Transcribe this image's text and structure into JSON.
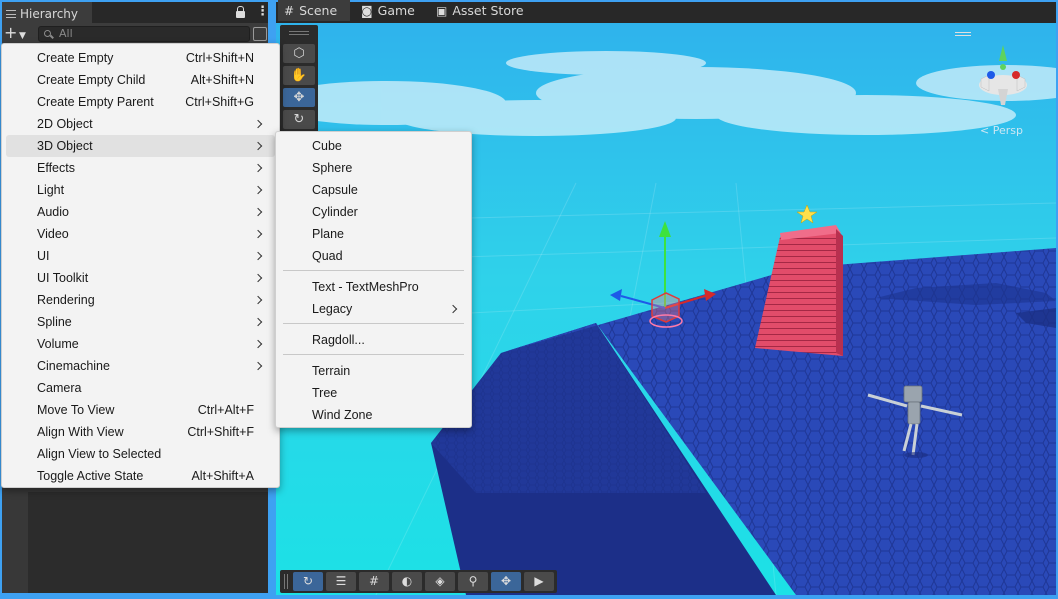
{
  "hierarchy": {
    "tab_title": "Hierarchy",
    "search_placeholder": "All",
    "add_icon": "plus-icon"
  },
  "scene": {
    "tabs": [
      {
        "label": "Scene",
        "icon": "hash-grid-icon",
        "active": true
      },
      {
        "label": "Game",
        "icon": "gamepad-icon",
        "active": false
      },
      {
        "label": "Asset Store",
        "icon": "shopping-bag-icon",
        "active": false
      }
    ],
    "camera_mode": "< Persp",
    "tools": [
      "view-cube-icon",
      "hand-tool-icon",
      "move-tool-icon",
      "rotate-tool-icon"
    ],
    "bottom_tools": [
      "orbit-icon",
      "sliders-icon",
      "grid-icon",
      "shading-icon",
      "layers-icon",
      "search-icon",
      "move-tool-icon",
      "camera-icon"
    ],
    "sky_color": "#21d6e6",
    "ground_color": "#2a49b8",
    "stairs_color": "#e24c6a"
  },
  "create_menu": {
    "items": [
      {
        "label": "Create Empty",
        "shortcut": "Ctrl+Shift+N"
      },
      {
        "label": "Create Empty Child",
        "shortcut": "Alt+Shift+N"
      },
      {
        "label": "Create Empty Parent",
        "shortcut": "Ctrl+Shift+G"
      },
      {
        "label": "2D Object",
        "submenu": true
      },
      {
        "label": "3D Object",
        "submenu": true,
        "highlighted": true
      },
      {
        "label": "Effects",
        "submenu": true
      },
      {
        "label": "Light",
        "submenu": true
      },
      {
        "label": "Audio",
        "submenu": true
      },
      {
        "label": "Video",
        "submenu": true
      },
      {
        "label": "UI",
        "submenu": true
      },
      {
        "label": "UI Toolkit",
        "submenu": true
      },
      {
        "label": "Rendering",
        "submenu": true
      },
      {
        "label": "Spline",
        "submenu": true
      },
      {
        "label": "Volume",
        "submenu": true
      },
      {
        "label": "Cinemachine",
        "submenu": true
      },
      {
        "label": "Camera"
      },
      {
        "label": "Move To View",
        "shortcut": "Ctrl+Alt+F"
      },
      {
        "label": "Align With View",
        "shortcut": "Ctrl+Shift+F"
      },
      {
        "label": "Align View to Selected"
      },
      {
        "label": "Toggle Active State",
        "shortcut": "Alt+Shift+A"
      }
    ]
  },
  "object3d_menu": {
    "groups": [
      [
        "Cube",
        "Sphere",
        "Capsule",
        "Cylinder",
        "Plane",
        "Quad"
      ],
      [
        "Text - TextMeshPro",
        "Legacy"
      ],
      [
        "Ragdoll..."
      ],
      [
        "Terrain",
        "Tree",
        "Wind Zone"
      ]
    ],
    "submenu_items": [
      "Legacy"
    ]
  }
}
